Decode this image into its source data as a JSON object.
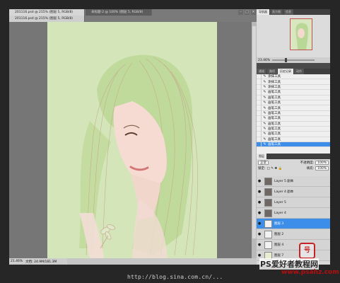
{
  "document": {
    "tabs": [
      {
        "label": "201116.psd @ 215% (图层 5, RGB/8)",
        "active": true
      },
      {
        "label": "未标题-2 @ 100% (图层 5, RGB/8)",
        "active": false
      }
    ],
    "second_tab_label": "201116.psd @ 215% (图层 5, RGB/8)",
    "window_controls": [
      "–",
      "□",
      "×"
    ],
    "zoom": "21.46%",
    "doc_size": "文档: 24.9M/181.3M"
  },
  "panels": {
    "navigator": {
      "tabs": [
        "导航器",
        "直方图",
        "信息"
      ],
      "zoom": "23.46%"
    },
    "history": {
      "tabs": [
        "通道",
        "路径",
        "历史记录",
        "动作"
      ],
      "items": [
        "涂抹工具",
        "涂抹工具",
        "涂抹工具",
        "画笔工具",
        "画笔工具",
        "画笔工具",
        "画笔工具",
        "画笔工具",
        "画笔工具",
        "画笔工具",
        "画笔工具",
        "画笔工具",
        "画笔工具",
        "画笔工具"
      ],
      "selected_index": 13
    },
    "layers": {
      "tabs": [
        "图层"
      ],
      "blend_mode": "正常",
      "opacity_label": "不透明度:",
      "opacity": "100%",
      "lock_label": "锁定:",
      "fill_label": "填充:",
      "fill": "100%",
      "items": [
        {
          "name": "Layer 5 副本",
          "thumb": "#6f6763"
        },
        {
          "name": "Layer 4 副本",
          "thumb": "#6f6763"
        },
        {
          "name": "Layer 5",
          "thumb": "#6f6763"
        },
        {
          "name": "Layer 4",
          "thumb": "#6f6763"
        },
        {
          "name": "图层 3",
          "thumb": "#f2f2f2",
          "selected": true
        },
        {
          "name": "图层 2",
          "thumb": "#f2f2f2"
        },
        {
          "name": "图层 4",
          "thumb": "#f2f2f2"
        },
        {
          "name": "图层 7",
          "thumb": "#e8edcf"
        }
      ]
    }
  },
  "watermarks": {
    "seal": "号",
    "site_cn": "PS爱好者教程网",
    "site_en": "www.psahz.com",
    "blog": "http://blog.sina.com.cn/..."
  },
  "colors": {
    "canvas_bg": "#d5e5ba",
    "selection": "#3d8ee8",
    "seal_red": "#c72326"
  }
}
